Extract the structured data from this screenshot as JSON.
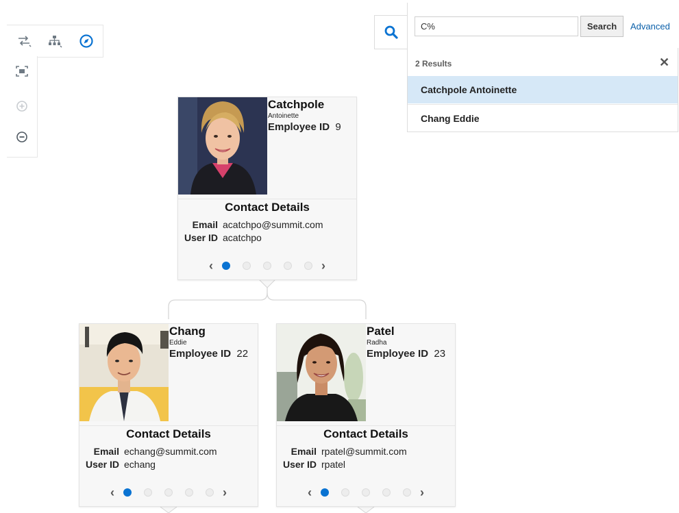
{
  "search": {
    "value": "C%",
    "button_label": "Search",
    "advanced_label": "Advanced",
    "results_count": "2 Results",
    "results": [
      {
        "label": "Catchpole  Antoinette",
        "selected": true
      },
      {
        "label": "Chang  Eddie",
        "selected": false
      }
    ]
  },
  "toolbar": {
    "icons": [
      "swap-layout-icon",
      "hierarchy-icon",
      "compass-icon",
      "fit-to-window-icon",
      "zoom-in-icon",
      "zoom-out-icon"
    ]
  },
  "colors": {
    "accent": "#0a73d2",
    "selected_row": "#d6e8f7",
    "card_bg": "#f7f7f7"
  },
  "cards": [
    {
      "last_name": "Catchpole",
      "first_name": "Antoinette",
      "employee_id_label": "Employee ID",
      "employee_id": "9",
      "section_title": "Contact Details",
      "email_label": "Email",
      "email": "acatchpo@summit.com",
      "userid_label": "User ID",
      "userid": "acatchpo"
    },
    {
      "last_name": "Chang",
      "first_name": "Eddie",
      "employee_id_label": "Employee ID",
      "employee_id": "22",
      "section_title": "Contact Details",
      "email_label": "Email",
      "email": "echang@summit.com",
      "userid_label": "User ID",
      "userid": "echang"
    },
    {
      "last_name": "Patel",
      "first_name": "Radha",
      "employee_id_label": "Employee ID",
      "employee_id": "23",
      "section_title": "Contact Details",
      "email_label": "Email",
      "email": "rpatel@summit.com",
      "userid_label": "User ID",
      "userid": "rpatel"
    }
  ],
  "pager": {
    "page_count": 5,
    "active_page": 1
  }
}
